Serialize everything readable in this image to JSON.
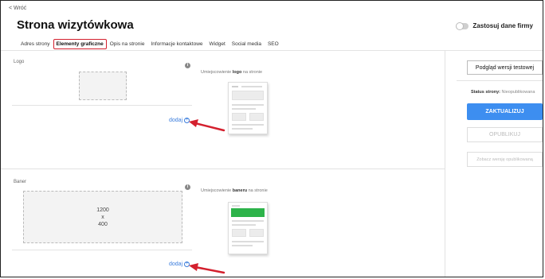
{
  "header": {
    "back_label": "< Wróć",
    "title": "Strona wizytówkowa",
    "toggle_label": "Zastosuj dane firmy"
  },
  "tabs": [
    {
      "label": "Adres strony",
      "active": false
    },
    {
      "label": "Elementy graficzne",
      "active": true
    },
    {
      "label": "Opis na stronie",
      "active": false
    },
    {
      "label": "Informacje kontaktowe",
      "active": false
    },
    {
      "label": "Widget",
      "active": false
    },
    {
      "label": "Social media",
      "active": false
    },
    {
      "label": "SEO",
      "active": false
    }
  ],
  "logo_section": {
    "label": "Logo",
    "caption_before": "Umiejscowienie ",
    "caption_bold": "logo",
    "caption_after": " na stronie",
    "add_label": "dodaj"
  },
  "banner_section": {
    "label": "Baner",
    "size_line1": "1200",
    "size_line2": "x",
    "size_line3": "400",
    "caption_before": "Umiejscowienie ",
    "caption_bold": "baneru",
    "caption_after": " na stronie",
    "add_label": "dodaj"
  },
  "sidebar": {
    "preview_button": "Podgląd wersji testowej",
    "status_label": "Status strony:",
    "status_value": "Nieopublikowana",
    "update_button": "ZAKTUALIZUJ",
    "publish_button": "OPUBLIKUJ",
    "view_published_button": "Zobacz wersję opublikowaną"
  },
  "colors": {
    "accent_blue": "#3d8ef0",
    "highlight_red": "#d4202e",
    "banner_green": "#2db34a"
  }
}
